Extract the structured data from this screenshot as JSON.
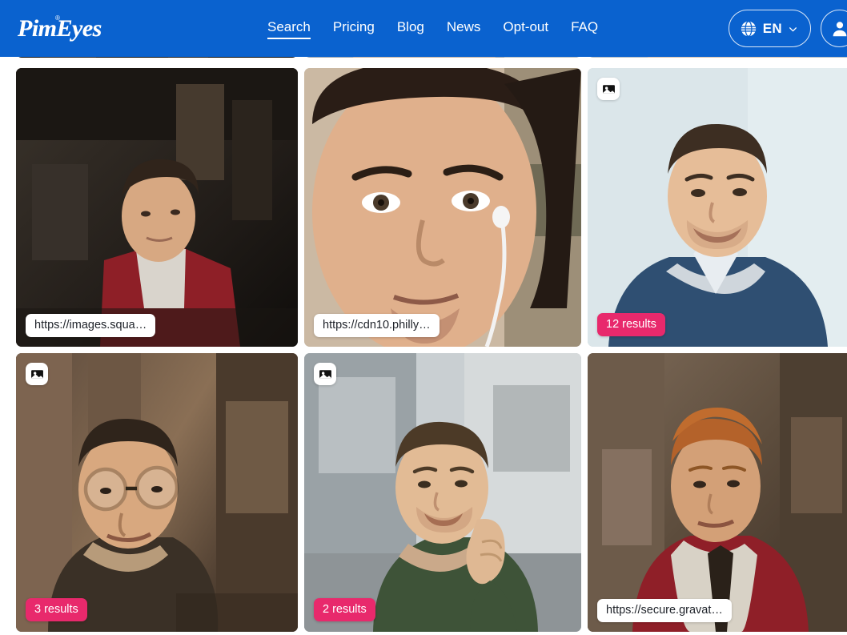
{
  "header": {
    "brand": "PimEyes",
    "brand_registered": "®",
    "nav": [
      {
        "label": "Search",
        "active": true
      },
      {
        "label": "Pricing",
        "active": false
      },
      {
        "label": "Blog",
        "active": false
      },
      {
        "label": "News",
        "active": false
      },
      {
        "label": "Opt-out",
        "active": false
      },
      {
        "label": "FAQ",
        "active": false
      }
    ],
    "language": {
      "code": "EN",
      "icon": "globe-icon",
      "chevron": "chevron-down-icon"
    },
    "account": {
      "icon": "user-avatar-icon"
    },
    "accent_color": "#0a62cf"
  },
  "results": {
    "badge_color": "#e8296c",
    "cut_row": [
      {
        "id": "cut-1"
      },
      {
        "id": "cut-2"
      },
      {
        "id": "cut-3"
      }
    ],
    "cards": [
      {
        "id": "card-1",
        "url": "https://images.squa…",
        "has_url": true,
        "results": null,
        "has_results": false,
        "has_image_flag": false,
        "alt": "man in red jacket looking to the side"
      },
      {
        "id": "card-2",
        "url": "https://cdn10.philly…",
        "has_url": true,
        "results": null,
        "has_results": false,
        "has_image_flag": false,
        "alt": "close-up of man with earphones"
      },
      {
        "id": "card-3",
        "url": null,
        "has_url": false,
        "results": "12 results",
        "has_results": true,
        "has_image_flag": true,
        "alt": "smiling man in blue shirt"
      },
      {
        "id": "card-4",
        "url": null,
        "has_url": false,
        "results": "3 results",
        "has_results": true,
        "has_image_flag": true,
        "alt": "man with glasses indoors"
      },
      {
        "id": "card-5",
        "url": null,
        "has_url": false,
        "results": "2 results",
        "has_results": true,
        "has_image_flag": true,
        "alt": "man in green shirt resting head on hand"
      },
      {
        "id": "card-6",
        "url": "https://secure.gravat…",
        "has_url": true,
        "results": null,
        "has_results": false,
        "has_image_flag": false,
        "alt": "man in red jacket with dark shirt"
      }
    ]
  }
}
